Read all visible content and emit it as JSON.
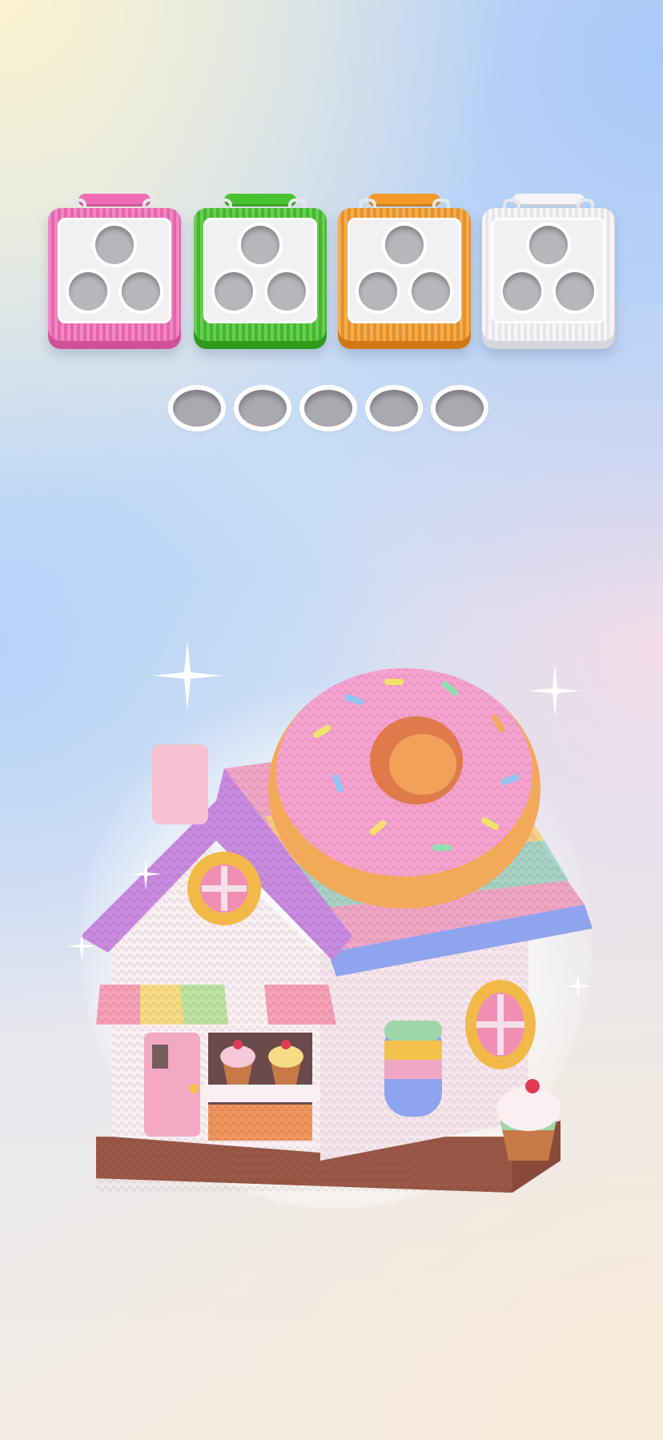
{
  "baskets": [
    {
      "color": "#f06cb6",
      "shade": "#d14f98",
      "slots": 3
    },
    {
      "color": "#48c22e",
      "shade": "#2f9a1c",
      "slots": 3
    },
    {
      "color": "#f39a2a",
      "shade": "#d27812",
      "slots": 3
    },
    {
      "color": "#f4f4f6",
      "shade": "#d6d6dc",
      "slots": 3
    }
  ],
  "holders": {
    "count": 5
  },
  "scene": {
    "subject": "crochet-candy-house",
    "colors": {
      "donut_frosting": "#f7a3cf",
      "donut_dough": "#f3a95a",
      "roof_trim": "#c98be0",
      "wall": "#fbeff2",
      "base": "#8a4a3a",
      "awning_pink": "#f7a0b7",
      "awning_yellow": "#f8dc84",
      "awning_green": "#bde3a0"
    }
  }
}
